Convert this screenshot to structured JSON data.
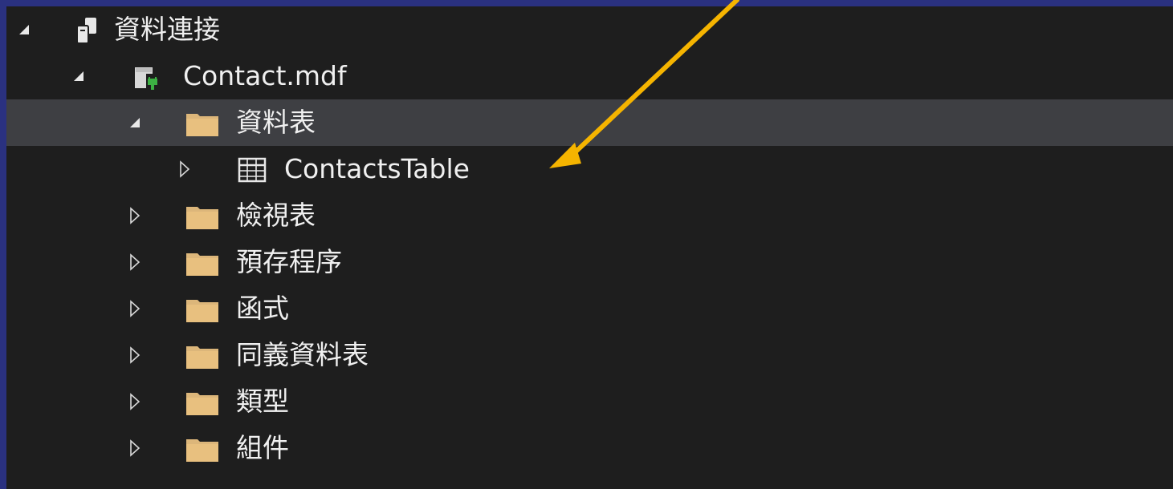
{
  "tree": {
    "root": {
      "label": "資料連接",
      "expanded": true,
      "icon": "data-connections-icon"
    },
    "database": {
      "label": "Contact.mdf",
      "expanded": true,
      "icon": "database-icon"
    },
    "tables_folder": {
      "label": "資料表",
      "expanded": true,
      "selected": true,
      "icon": "folder-icon"
    },
    "table_item": {
      "label": "ContactsTable",
      "expanded": false,
      "icon": "table-icon"
    },
    "views_folder": {
      "label": "檢視表",
      "expanded": false,
      "icon": "folder-icon"
    },
    "procs_folder": {
      "label": "預存程序",
      "expanded": false,
      "icon": "folder-icon"
    },
    "functions_folder": {
      "label": "函式",
      "expanded": false,
      "icon": "folder-icon"
    },
    "synonyms_folder": {
      "label": "同義資料表",
      "expanded": false,
      "icon": "folder-icon"
    },
    "types_folder": {
      "label": "類型",
      "expanded": false,
      "icon": "folder-icon"
    },
    "assemblies_folder": {
      "label": "組件",
      "expanded": false,
      "icon": "folder-icon"
    }
  },
  "colors": {
    "background": "#1e1e1e",
    "border": "#2a3180",
    "selection": "#3e3f43",
    "folder": "#dcb67a",
    "annotation_arrow": "#f5b400"
  }
}
